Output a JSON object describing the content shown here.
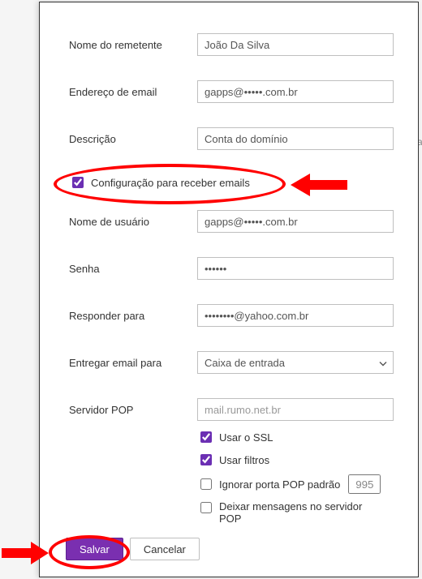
{
  "labels": {
    "sender_name": "Nome do remetente",
    "email_address": "Endereço de email",
    "description": "Descrição",
    "receive_config": "Configuração para receber emails",
    "username": "Nome de usuário",
    "password": "Senha",
    "reply_to": "Responder para",
    "deliver_to": "Entregar email para",
    "pop_server": "Servidor POP"
  },
  "values": {
    "sender_name": "João Da Silva",
    "email_address_prefix": "gapps@",
    "email_address_suffix": ".com.br",
    "description": "Conta do domínio",
    "username_prefix": "gapps@",
    "username_suffix": ".com.br",
    "password": "••••••",
    "reply_to_suffix": "@yahoo.com.br",
    "deliver_to": "Caixa de entrada",
    "pop_server": "mail.rumo.net.br",
    "port": "995"
  },
  "options": {
    "use_ssl": "Usar o SSL",
    "use_filters": "Usar filtros",
    "ignore_port": "Ignorar porta POP padrão",
    "leave_messages": "Deixar mensagens no servidor POP"
  },
  "buttons": {
    "save": "Salvar",
    "cancel": "Cancelar"
  },
  "checked": {
    "receive_config": true,
    "use_ssl": true,
    "use_filters": true,
    "ignore_port": false,
    "leave_messages": false
  }
}
